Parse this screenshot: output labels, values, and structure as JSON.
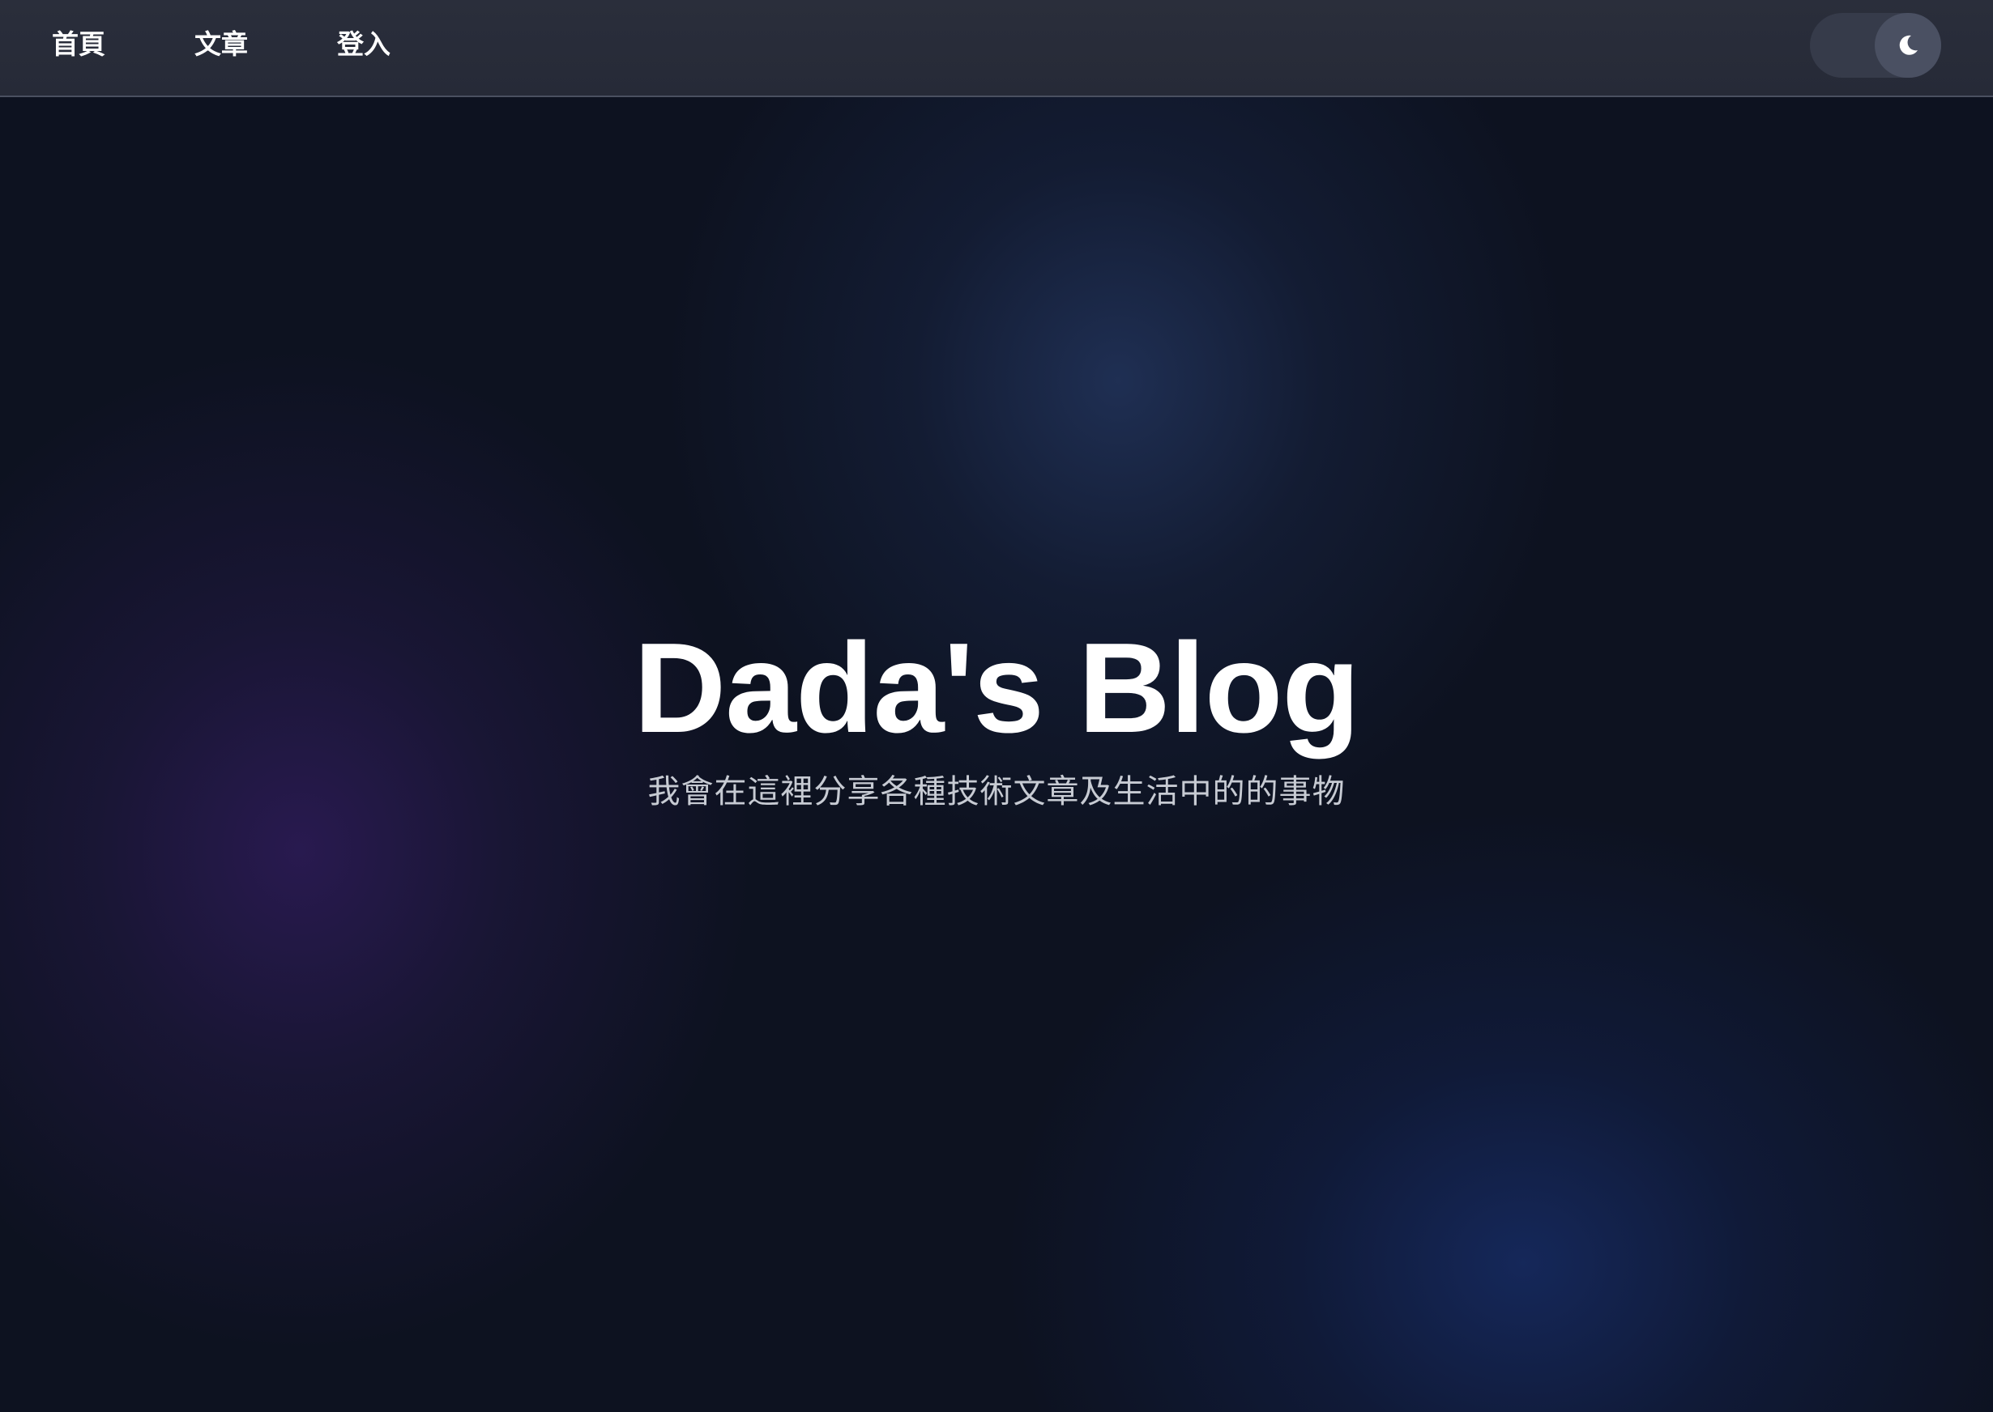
{
  "nav": {
    "items": [
      {
        "label": "首頁"
      },
      {
        "label": "文章"
      },
      {
        "label": "登入"
      }
    ],
    "theme_toggle": {
      "icon": "moon-icon",
      "mode": "dark"
    }
  },
  "hero": {
    "title": "Dada's Blog",
    "subtitle": "我會在這裡分享各種技術文章及生活中的的事物"
  },
  "colors": {
    "background": "#0d1220",
    "navbar": "#2a2e3b",
    "title": "#ffffff",
    "subtitle": "#c7cbd3"
  }
}
